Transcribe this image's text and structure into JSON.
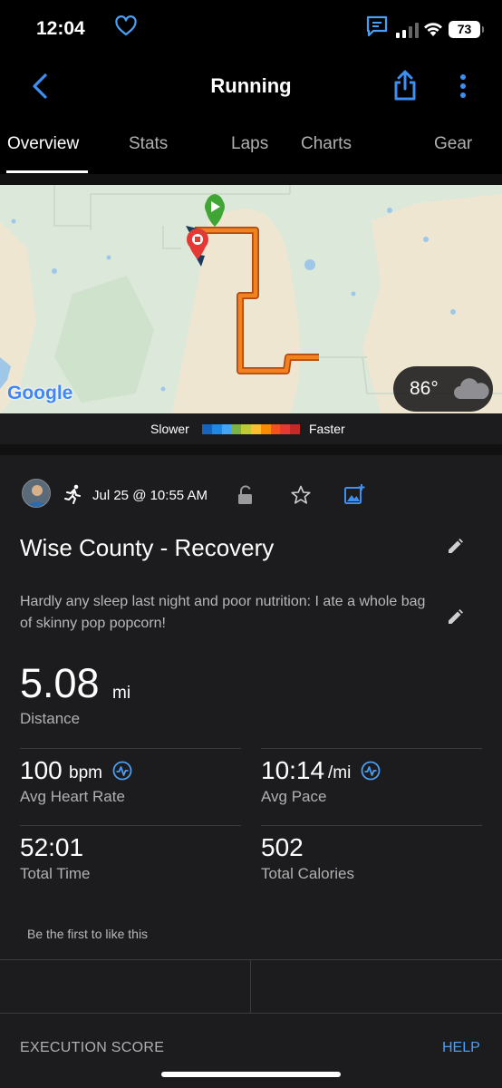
{
  "status_bar": {
    "time": "12:04",
    "battery_level": "73",
    "icons": [
      "signal-icon",
      "wifi-icon",
      "battery-icon"
    ]
  },
  "nav": {
    "title": "Running",
    "icons": [
      "back-icon",
      "share-icon",
      "more-icon"
    ]
  },
  "tabs": [
    {
      "label": "Overview",
      "active": true
    },
    {
      "label": "Stats",
      "active": false
    },
    {
      "label": "Laps",
      "active": false
    },
    {
      "label": "Charts",
      "active": false
    },
    {
      "label": "Gear",
      "active": false
    }
  ],
  "map": {
    "provider_logo": "Google",
    "temperature": "86°",
    "weather_icon": "cloud-icon",
    "route_color": "#e8731c",
    "start_marker_color": "#3fa535",
    "stop_marker_color": "#e53935"
  },
  "pace_legend": {
    "slower_label": "Slower",
    "faster_label": "Faster",
    "colors": [
      "#1565c0",
      "#1e88e5",
      "#42a5f5",
      "#7cb342",
      "#c0ca33",
      "#fbc02d",
      "#fb8c00",
      "#f4511e",
      "#e53935",
      "#c62828"
    ]
  },
  "activity": {
    "date": "Jul 25 @ 10:55 AM",
    "activity_icon": "run-icon",
    "title": "Wise County - Recovery",
    "notes": "Hardly any sleep last night and poor nutrition: I ate a whole bag of skinny pop popcorn!"
  },
  "distance": {
    "value": "5.08",
    "unit": "mi",
    "label": "Distance"
  },
  "stats": {
    "heart_rate": {
      "value": "100",
      "unit": "bpm",
      "label": "Avg Heart Rate"
    },
    "pace": {
      "value": "10:14",
      "unit": "/mi",
      "label": "Avg Pace"
    },
    "time": {
      "value": "52:01",
      "label": "Total Time"
    },
    "calories": {
      "value": "502",
      "label": "Total Calories"
    }
  },
  "social": {
    "like_text": "Be the first to like this"
  },
  "execution": {
    "label": "EXECUTION SCORE",
    "help": "HELP"
  },
  "colors": {
    "accent_blue": "#4a9ff5",
    "background": "#1c1c1e"
  }
}
